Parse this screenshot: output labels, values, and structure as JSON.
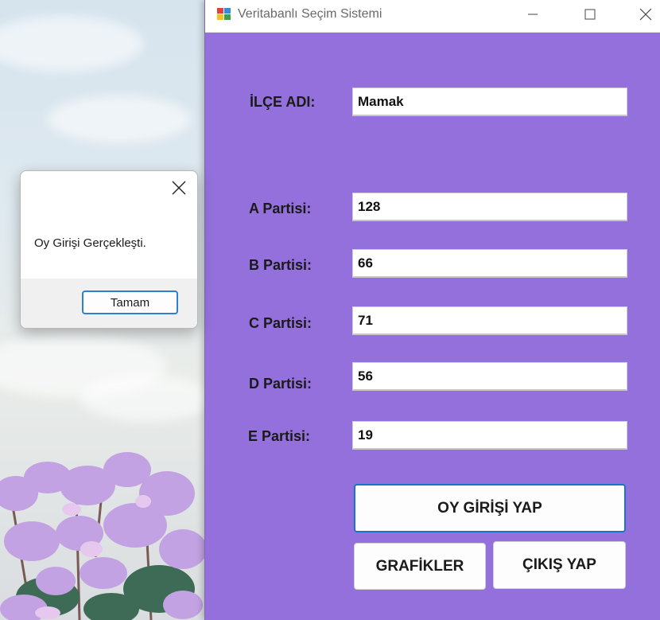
{
  "window": {
    "title": "Veritabanlı Seçim Sistemi",
    "background_color": "#9370db"
  },
  "form": {
    "district_label": "İLÇE ADI:",
    "district_value": "Mamak",
    "parties": [
      {
        "label": "A Partisi:",
        "value": "128"
      },
      {
        "label": "B Partisi:",
        "value": "66"
      },
      {
        "label": "C Partisi:",
        "value": "71"
      },
      {
        "label": "D Partisi:",
        "value": "56"
      },
      {
        "label": "E Partisi:",
        "value": "19"
      }
    ]
  },
  "buttons": {
    "submit_vote": "OY GİRİŞİ YAP",
    "charts": "GRAFİKLER",
    "exit": "ÇIKIŞ YAP"
  },
  "dialog": {
    "message": "Oy Girişi Gerçekleşti.",
    "ok_label": "Tamam"
  }
}
